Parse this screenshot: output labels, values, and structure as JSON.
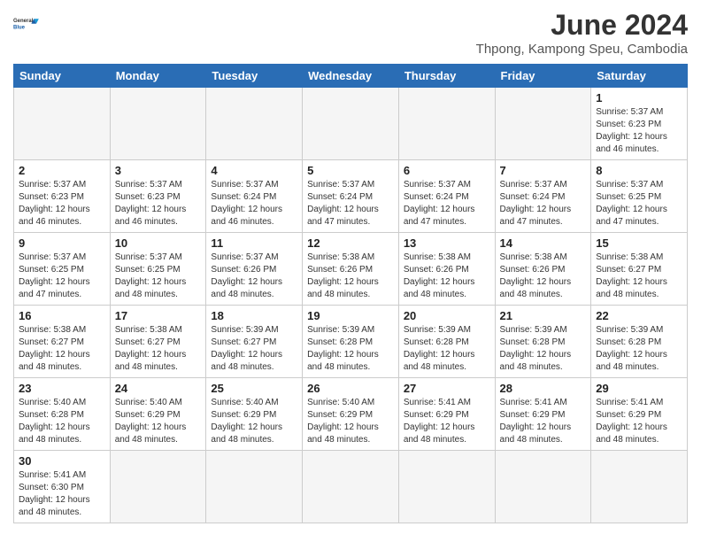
{
  "header": {
    "logo_line1": "General",
    "logo_line2": "Blue",
    "title": "June 2024",
    "subtitle": "Thpong, Kampong Speu, Cambodia"
  },
  "days_of_week": [
    "Sunday",
    "Monday",
    "Tuesday",
    "Wednesday",
    "Thursday",
    "Friday",
    "Saturday"
  ],
  "weeks": [
    [
      {
        "day": "",
        "empty": true
      },
      {
        "day": "",
        "empty": true
      },
      {
        "day": "",
        "empty": true
      },
      {
        "day": "",
        "empty": true
      },
      {
        "day": "",
        "empty": true
      },
      {
        "day": "",
        "empty": true
      },
      {
        "day": "1",
        "sunrise": "5:37 AM",
        "sunset": "6:23 PM",
        "daylight": "12 hours and 46 minutes."
      }
    ],
    [
      {
        "day": "2",
        "sunrise": "5:37 AM",
        "sunset": "6:23 PM",
        "daylight": "12 hours and 46 minutes."
      },
      {
        "day": "3",
        "sunrise": "5:37 AM",
        "sunset": "6:23 PM",
        "daylight": "12 hours and 46 minutes."
      },
      {
        "day": "4",
        "sunrise": "5:37 AM",
        "sunset": "6:24 PM",
        "daylight": "12 hours and 46 minutes."
      },
      {
        "day": "5",
        "sunrise": "5:37 AM",
        "sunset": "6:24 PM",
        "daylight": "12 hours and 47 minutes."
      },
      {
        "day": "6",
        "sunrise": "5:37 AM",
        "sunset": "6:24 PM",
        "daylight": "12 hours and 47 minutes."
      },
      {
        "day": "7",
        "sunrise": "5:37 AM",
        "sunset": "6:24 PM",
        "daylight": "12 hours and 47 minutes."
      },
      {
        "day": "8",
        "sunrise": "5:37 AM",
        "sunset": "6:25 PM",
        "daylight": "12 hours and 47 minutes."
      }
    ],
    [
      {
        "day": "9",
        "sunrise": "5:37 AM",
        "sunset": "6:25 PM",
        "daylight": "12 hours and 47 minutes."
      },
      {
        "day": "10",
        "sunrise": "5:37 AM",
        "sunset": "6:25 PM",
        "daylight": "12 hours and 48 minutes."
      },
      {
        "day": "11",
        "sunrise": "5:37 AM",
        "sunset": "6:26 PM",
        "daylight": "12 hours and 48 minutes."
      },
      {
        "day": "12",
        "sunrise": "5:38 AM",
        "sunset": "6:26 PM",
        "daylight": "12 hours and 48 minutes."
      },
      {
        "day": "13",
        "sunrise": "5:38 AM",
        "sunset": "6:26 PM",
        "daylight": "12 hours and 48 minutes."
      },
      {
        "day": "14",
        "sunrise": "5:38 AM",
        "sunset": "6:26 PM",
        "daylight": "12 hours and 48 minutes."
      },
      {
        "day": "15",
        "sunrise": "5:38 AM",
        "sunset": "6:27 PM",
        "daylight": "12 hours and 48 minutes."
      }
    ],
    [
      {
        "day": "16",
        "sunrise": "5:38 AM",
        "sunset": "6:27 PM",
        "daylight": "12 hours and 48 minutes."
      },
      {
        "day": "17",
        "sunrise": "5:38 AM",
        "sunset": "6:27 PM",
        "daylight": "12 hours and 48 minutes."
      },
      {
        "day": "18",
        "sunrise": "5:39 AM",
        "sunset": "6:27 PM",
        "daylight": "12 hours and 48 minutes."
      },
      {
        "day": "19",
        "sunrise": "5:39 AM",
        "sunset": "6:28 PM",
        "daylight": "12 hours and 48 minutes."
      },
      {
        "day": "20",
        "sunrise": "5:39 AM",
        "sunset": "6:28 PM",
        "daylight": "12 hours and 48 minutes."
      },
      {
        "day": "21",
        "sunrise": "5:39 AM",
        "sunset": "6:28 PM",
        "daylight": "12 hours and 48 minutes."
      },
      {
        "day": "22",
        "sunrise": "5:39 AM",
        "sunset": "6:28 PM",
        "daylight": "12 hours and 48 minutes."
      }
    ],
    [
      {
        "day": "23",
        "sunrise": "5:40 AM",
        "sunset": "6:28 PM",
        "daylight": "12 hours and 48 minutes."
      },
      {
        "day": "24",
        "sunrise": "5:40 AM",
        "sunset": "6:29 PM",
        "daylight": "12 hours and 48 minutes."
      },
      {
        "day": "25",
        "sunrise": "5:40 AM",
        "sunset": "6:29 PM",
        "daylight": "12 hours and 48 minutes."
      },
      {
        "day": "26",
        "sunrise": "5:40 AM",
        "sunset": "6:29 PM",
        "daylight": "12 hours and 48 minutes."
      },
      {
        "day": "27",
        "sunrise": "5:41 AM",
        "sunset": "6:29 PM",
        "daylight": "12 hours and 48 minutes."
      },
      {
        "day": "28",
        "sunrise": "5:41 AM",
        "sunset": "6:29 PM",
        "daylight": "12 hours and 48 minutes."
      },
      {
        "day": "29",
        "sunrise": "5:41 AM",
        "sunset": "6:29 PM",
        "daylight": "12 hours and 48 minutes."
      }
    ],
    [
      {
        "day": "30",
        "sunrise": "5:41 AM",
        "sunset": "6:30 PM",
        "daylight": "12 hours and 48 minutes.",
        "last_row": true
      },
      {
        "day": "",
        "empty": true,
        "last_row": true
      },
      {
        "day": "",
        "empty": true,
        "last_row": true
      },
      {
        "day": "",
        "empty": true,
        "last_row": true
      },
      {
        "day": "",
        "empty": true,
        "last_row": true
      },
      {
        "day": "",
        "empty": true,
        "last_row": true
      },
      {
        "day": "",
        "empty": true,
        "last_row": true
      }
    ]
  ]
}
